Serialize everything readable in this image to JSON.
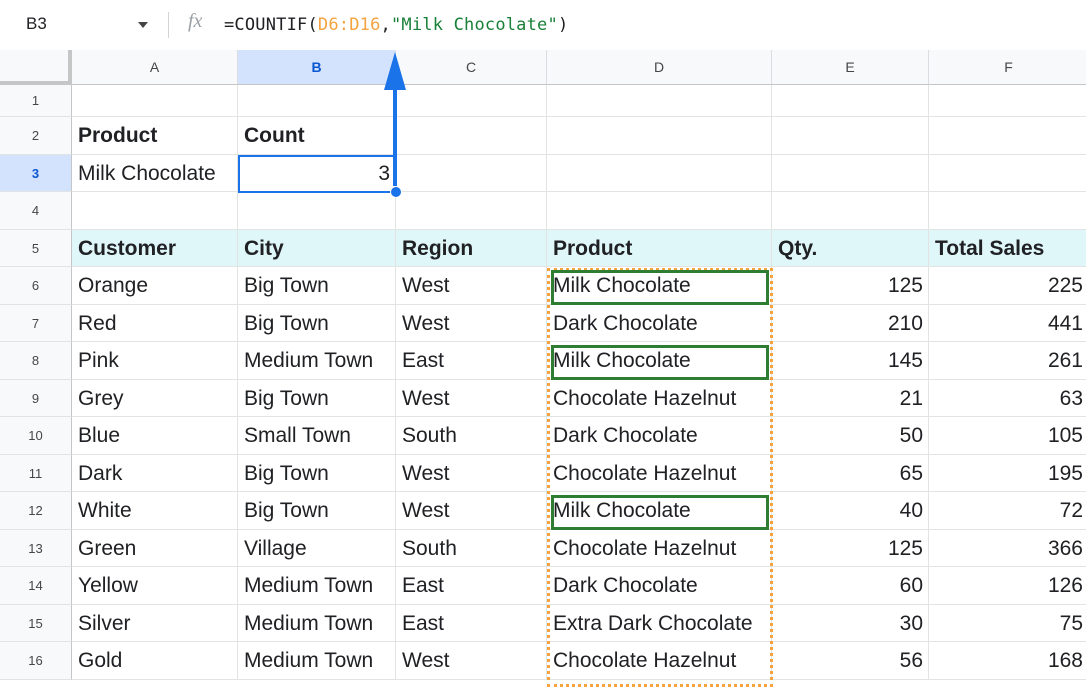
{
  "formula_bar": {
    "name_box": "B3",
    "fx": "fx",
    "formula_prefix": "=COUNTIF(",
    "formula_range": "D6:D16",
    "formula_comma": ",",
    "formula_string": "\"Milk Chocolate\"",
    "formula_suffix": ")"
  },
  "columns": [
    "A",
    "B",
    "C",
    "D",
    "E",
    "F"
  ],
  "selected_column": "B",
  "selected_row": "3",
  "rows": [
    {
      "num": "1",
      "cells": [
        "",
        "",
        "",
        "",
        "",
        ""
      ]
    },
    {
      "num": "2",
      "cells": [
        "Product",
        "Count",
        "",
        "",
        "",
        ""
      ]
    },
    {
      "num": "3",
      "cells": [
        "Milk Chocolate",
        "3",
        "",
        "",
        "",
        ""
      ]
    },
    {
      "num": "4",
      "cells": [
        "",
        "",
        "",
        "",
        "",
        ""
      ]
    },
    {
      "num": "5",
      "cells": [
        "Customer",
        "City",
        "Region",
        "Product",
        "Qty.",
        "Total Sales"
      ]
    },
    {
      "num": "6",
      "cells": [
        "Orange",
        "Big Town",
        "West",
        "Milk Chocolate",
        "125",
        "225"
      ]
    },
    {
      "num": "7",
      "cells": [
        "Red",
        "Big Town",
        "West",
        "Dark Chocolate",
        "210",
        "441"
      ]
    },
    {
      "num": "8",
      "cells": [
        "Pink",
        "Medium Town",
        "East",
        "Milk Chocolate",
        "145",
        "261"
      ]
    },
    {
      "num": "9",
      "cells": [
        "Grey",
        "Big Town",
        "West",
        "Chocolate Hazelnut",
        "21",
        "63"
      ]
    },
    {
      "num": "10",
      "cells": [
        "Blue",
        "Small Town",
        "South",
        "Dark Chocolate",
        "50",
        "105"
      ]
    },
    {
      "num": "11",
      "cells": [
        "Dark",
        "Big Town",
        "West",
        "Chocolate Hazelnut",
        "65",
        "195"
      ]
    },
    {
      "num": "12",
      "cells": [
        "White",
        "Big Town",
        "West",
        "Milk Chocolate",
        "40",
        "72"
      ]
    },
    {
      "num": "13",
      "cells": [
        "Green",
        "Village",
        "South",
        "Chocolate Hazelnut",
        "125",
        "366"
      ]
    },
    {
      "num": "14",
      "cells": [
        "Yellow",
        "Medium Town",
        "East",
        "Dark Chocolate",
        "60",
        "126"
      ]
    },
    {
      "num": "15",
      "cells": [
        "Silver",
        "Medium Town",
        "East",
        "Extra Dark Chocolate",
        "30",
        "75"
      ]
    },
    {
      "num": "16",
      "cells": [
        "Gold",
        "Medium Town",
        "West",
        "Chocolate Hazelnut",
        "56",
        "168"
      ]
    }
  ],
  "header_row": "5",
  "bold_rows": [
    "2"
  ],
  "numeric_columns": [
    "E",
    "F"
  ],
  "numeric_cells": [
    "B3"
  ],
  "match_rows": [
    "6",
    "8",
    "12"
  ],
  "colors": {
    "selection": "#1a73e8",
    "header_fill": "#e0f7fa",
    "range_highlight": "#f4a33f",
    "match_highlight": "#2e7d32",
    "arrow": "#1a73e8"
  },
  "icons": {
    "name_box_dropdown": "chevron-down-icon",
    "formula": "fx-icon",
    "annotation": "arrow-up-icon"
  }
}
